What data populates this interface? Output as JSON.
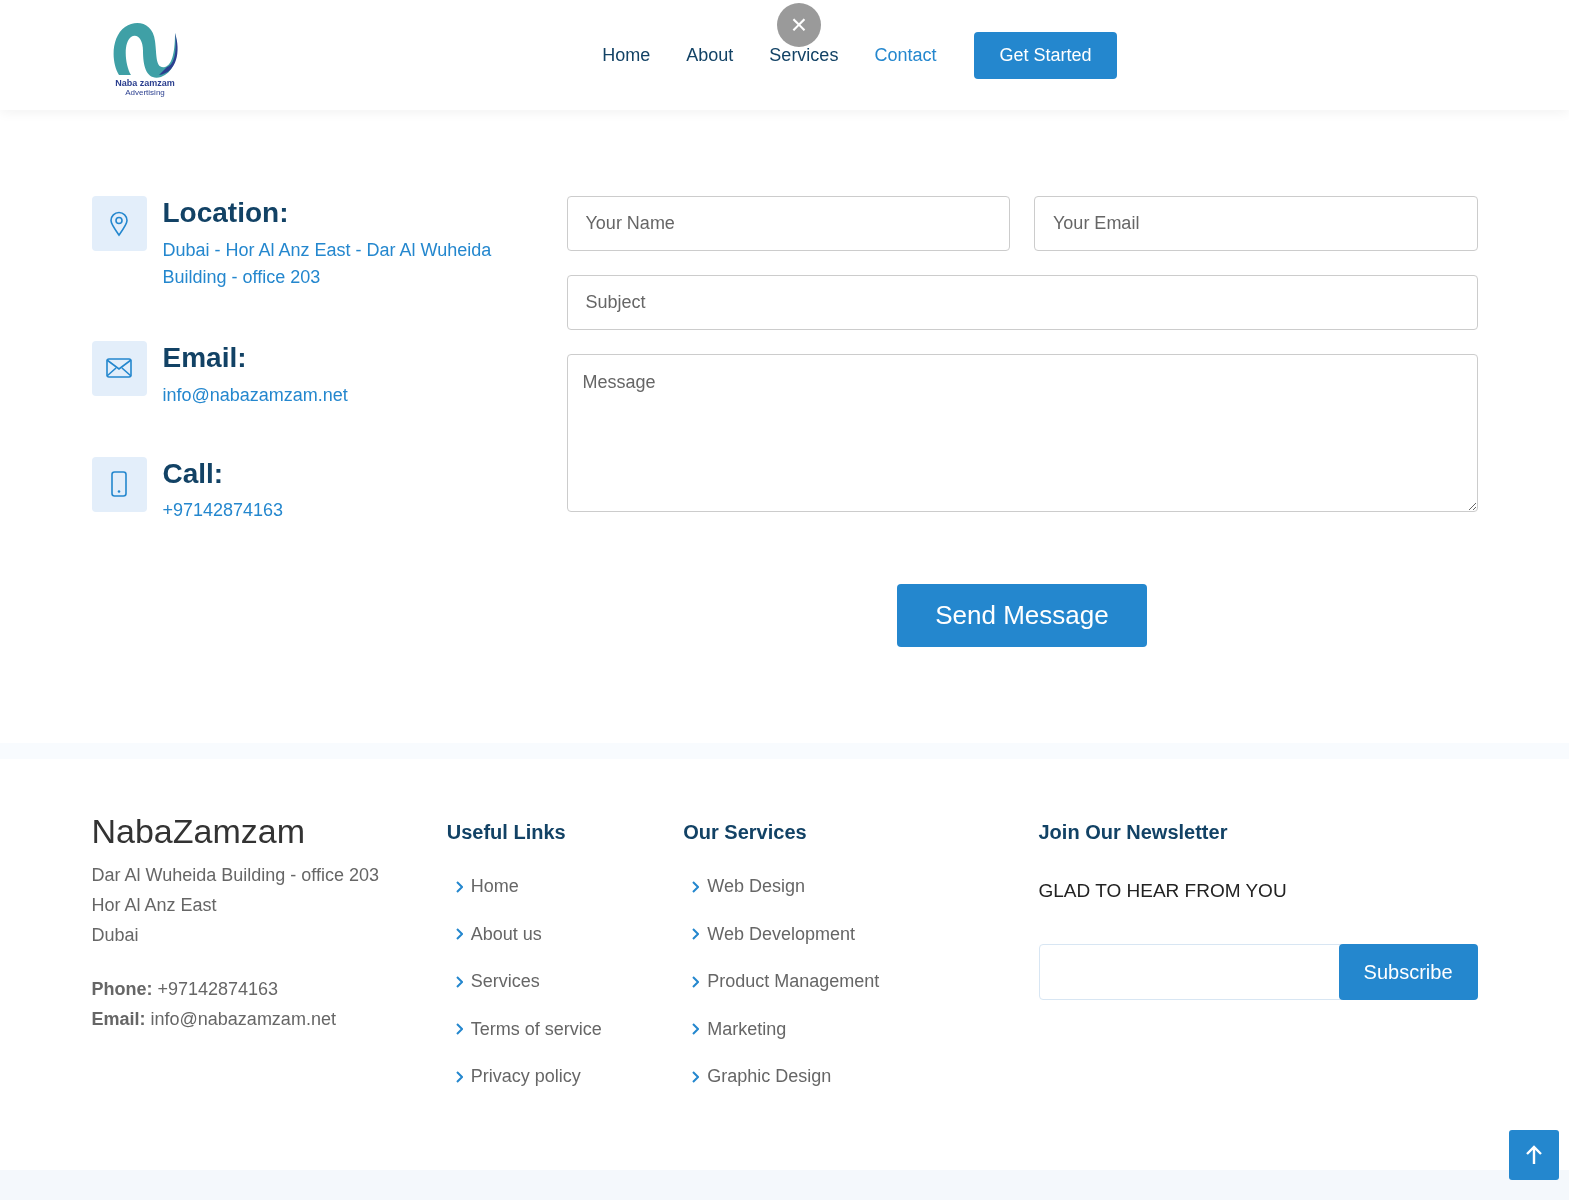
{
  "header": {
    "logo": {
      "name": "Naba zamzam",
      "tagline": "Advertising"
    },
    "nav": [
      {
        "label": "Home",
        "selected": false
      },
      {
        "label": "About",
        "selected": false
      },
      {
        "label": "Services",
        "selected": false
      },
      {
        "label": "Contact",
        "selected": true
      }
    ],
    "cta": "Get Started",
    "close_button": "×"
  },
  "contact": {
    "info": [
      {
        "kind": "location",
        "title": "Location:",
        "value": "Dubai - Hor Al Anz East - Dar Al Wuheida Building - office 203"
      },
      {
        "kind": "email",
        "title": "Email:",
        "value": "info@nabazamzam.net"
      },
      {
        "kind": "phone",
        "title": "Call:",
        "value": "+97142874163"
      }
    ],
    "form": {
      "name_placeholder": "Your Name",
      "email_placeholder": "Your Email",
      "subject_placeholder": "Subject",
      "message_placeholder": "Message",
      "submit": "Send Message"
    }
  },
  "footer": {
    "brand": "NabaZamzam",
    "address": [
      "Dar Al Wuheida Building - office 203",
      "Hor Al Anz East",
      "Dubai"
    ],
    "phone_label": "Phone:",
    "phone": "+97142874163",
    "email_label": "Email:",
    "email": "info@nabazamzam.net",
    "useful_links": {
      "title": "Useful Links",
      "items": [
        "Home",
        "About us",
        "Services",
        "Terms of service",
        "Privacy policy"
      ]
    },
    "services": {
      "title": "Our Services",
      "items": [
        "Web Design",
        "Web Development",
        "Product Management",
        "Marketing",
        "Graphic Design"
      ]
    },
    "newsletter": {
      "title": "Join Our Newsletter",
      "text": "GLAD TO HEAR FROM YOU",
      "button": "Subscribe"
    }
  }
}
